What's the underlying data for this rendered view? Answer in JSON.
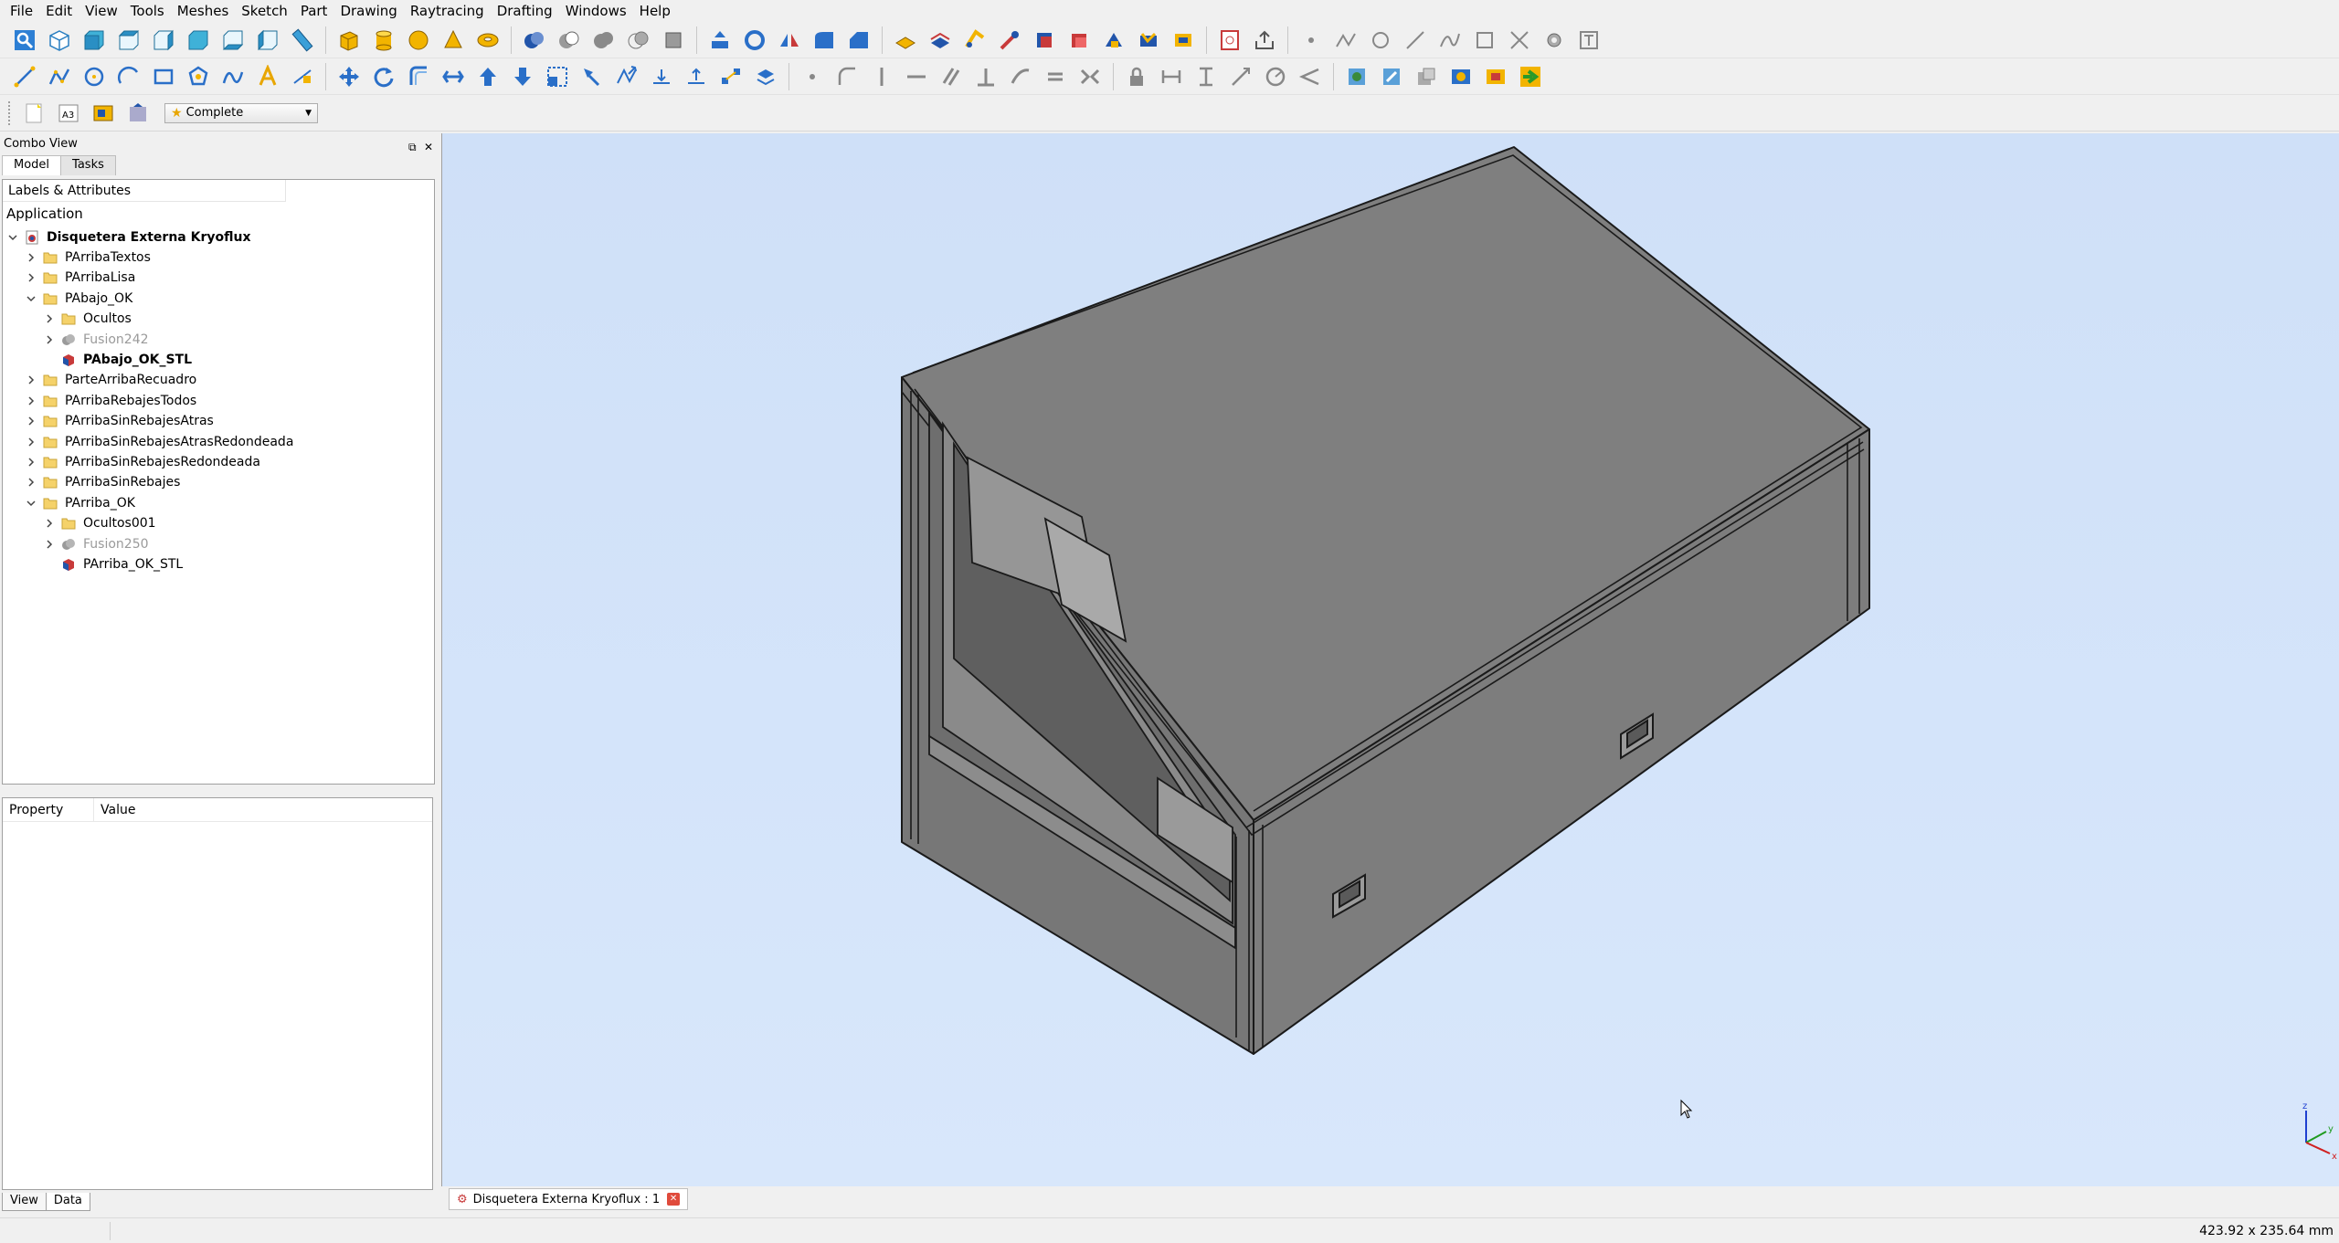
{
  "menu": [
    "File",
    "Edit",
    "View",
    "Tools",
    "Meshes",
    "Sketch",
    "Part",
    "Drawing",
    "Raytracing",
    "Drafting",
    "Windows",
    "Help"
  ],
  "workbench": {
    "selected": "Complete"
  },
  "combo": {
    "title": "Combo View",
    "tabs": [
      "Model",
      "Tasks"
    ],
    "tree_header": "Labels & Attributes",
    "application": "Application",
    "document": "Disquetera Externa Kryoflux",
    "items": [
      {
        "label": "PArribaTextos"
      },
      {
        "label": "PArribaLisa"
      },
      {
        "label": "PAbajo_OK"
      },
      {
        "label": "Ocultos"
      },
      {
        "label": "Fusion242"
      },
      {
        "label": "PAbajo_OK_STL"
      },
      {
        "label": "ParteArribaRecuadro"
      },
      {
        "label": "PArribaRebajesTodos"
      },
      {
        "label": "PArribaSinRebajesAtras"
      },
      {
        "label": "PArribaSinRebajesAtrasRedondeada"
      },
      {
        "label": "PArribaSinRebajesRedondeada"
      },
      {
        "label": "PArribaSinRebajes"
      },
      {
        "label": "PArriba_OK"
      },
      {
        "label": "Ocultos001"
      },
      {
        "label": "Fusion250"
      },
      {
        "label": "PArriba_OK_STL"
      }
    ],
    "props_headers": [
      "Property",
      "Value"
    ],
    "bottom_tabs": [
      "View",
      "Data"
    ]
  },
  "document_tab": "Disquetera Externa Kryoflux : 1",
  "status": {
    "dimensions": "423.92 x 235.64 mm"
  },
  "colors": {
    "viewport_bg": "#d4e4fa",
    "model_gray": "#7f7f7f",
    "accent": "#2b7bd6"
  }
}
